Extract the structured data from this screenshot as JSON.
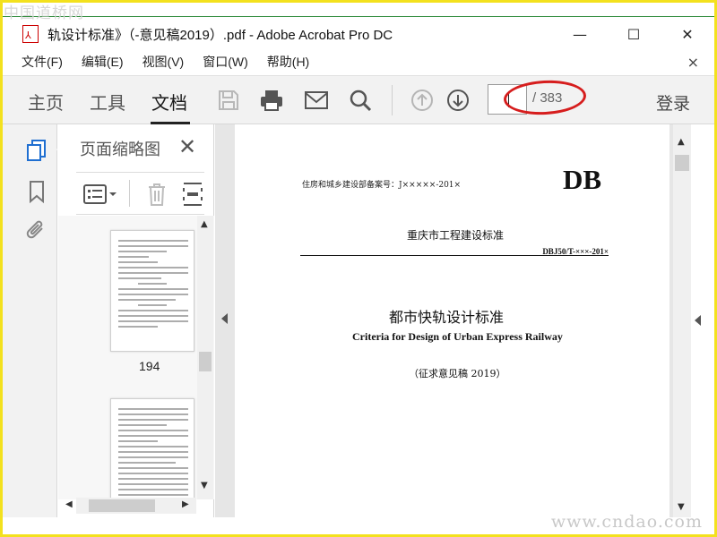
{
  "watermark": {
    "top": "中国道桥网",
    "bottom": "www.cndao.com"
  },
  "window": {
    "title": "轨设计标准》（-意见稿2019）.pdf - Adobe Acrobat Pro DC",
    "controls": {
      "minimize": "—",
      "maximize": "☐",
      "close": "✕"
    }
  },
  "menu": {
    "items": [
      "文件(F)",
      "编辑(E)",
      "视图(V)",
      "窗口(W)",
      "帮助(H)"
    ],
    "close": "×"
  },
  "toolbar": {
    "tabs": [
      "主页",
      "工具",
      "文档"
    ],
    "active_tab": "文档",
    "page_input": "",
    "page_total": "/ 383",
    "login": "登录",
    "highlight_color": "#d61d1d"
  },
  "sidebar": {
    "title": "页面缩略图",
    "close": "✕",
    "thumbnail_page_label": "194"
  },
  "document": {
    "registration": "住房和城乡建设部备案号：J×××××-201×",
    "db": "DB",
    "standard_type": "重庆市工程建设标准",
    "code": "DBJ50/T-×××-201×",
    "title_cn": "都市快轨设计标准",
    "title_en": "Criteria for Design of Urban Express Railway",
    "draft_note": "（征求意见稿 2019）"
  }
}
